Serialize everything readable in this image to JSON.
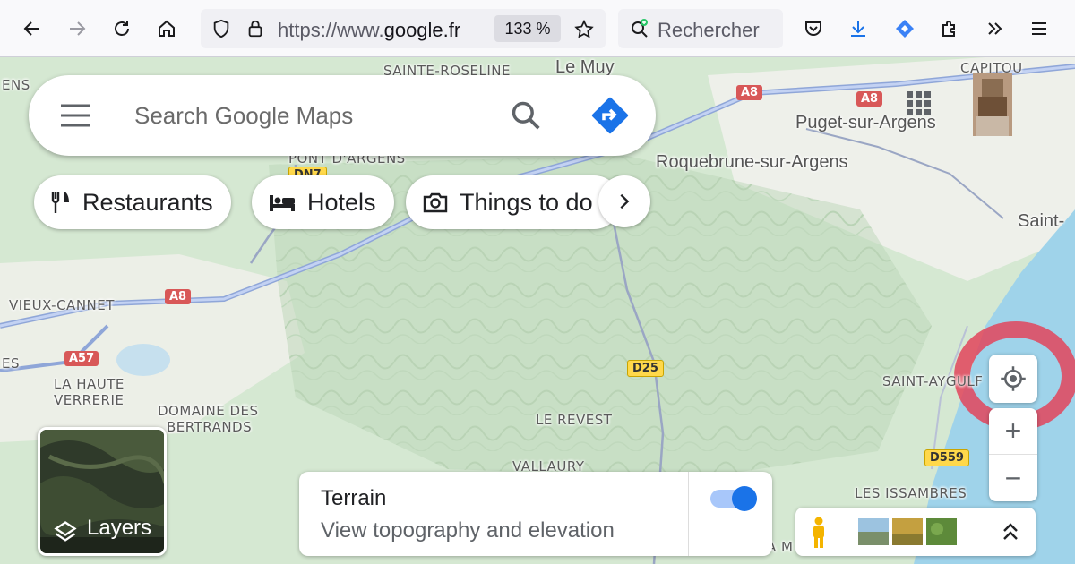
{
  "browser": {
    "url_prefix": "https://www.",
    "url_domain": "google.fr",
    "zoom_level": "133 %",
    "search_placeholder": "Rechercher"
  },
  "maps": {
    "search_placeholder": "Search Google Maps",
    "chips": [
      {
        "label": "Restaurants",
        "icon": "restaurant-icon"
      },
      {
        "label": "Hotels",
        "icon": "hotel-icon"
      },
      {
        "label": "Things to do",
        "icon": "camera-icon"
      }
    ],
    "layers_label": "Layers",
    "terrain": {
      "title": "Terrain",
      "subtitle": "View topography and elevation",
      "enabled": true
    },
    "zoom_in": "+",
    "zoom_out": "−"
  },
  "map_labels": {
    "sainte_roseline": "SAINTE-ROSELINE",
    "le_muy": "Le Muy",
    "capitou": "CAPITOU",
    "puget": "Puget-sur-Argens",
    "roquebrune": "Roquebrune-sur-Argens",
    "pont_dargens": "PONT D'ARGENS",
    "saint_r": "Saint-",
    "vieux_cannet": "VIEUX-CANNET",
    "la_haute_verrerie_1": "LA HAUTE",
    "la_haute_verrerie_2": "VERRERIE",
    "domaine_1": "DOMAINE DES",
    "domaine_2": "BERTRANDS",
    "le_revest": "LE REVEST",
    "vallaury": "VALLAURY",
    "saint_aygulf": "SAINT-AYGULF",
    "les_issambres": "LES ISSAMBRES",
    "ens": "ENS",
    "es": "ES",
    "a_m": "A M"
  },
  "road_shields": {
    "a8_top": "A8",
    "a8_right": "A8",
    "a8_left": "A8",
    "a57": "A57",
    "dn7": "DN7",
    "d25": "D25",
    "d559": "D559"
  }
}
